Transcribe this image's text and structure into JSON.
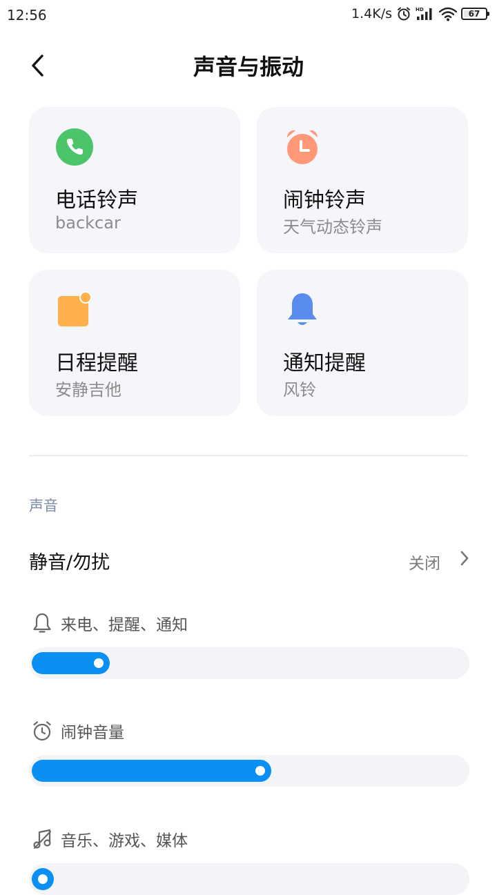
{
  "status_bar": {
    "time": "12:56",
    "net_speed": "1.4K/s",
    "battery": "67"
  },
  "header": {
    "title": "声音与振动"
  },
  "cards": [
    {
      "title": "电话铃声",
      "subtitle": "backcar",
      "icon": "phone-icon",
      "color": "#4cc46a"
    },
    {
      "title": "闹钟铃声",
      "subtitle": "天气动态铃声",
      "icon": "alarm-clock-icon",
      "color": "#ff9878"
    },
    {
      "title": "日程提醒",
      "subtitle": "安静吉他",
      "icon": "calendar-icon",
      "color": "#ffb04a"
    },
    {
      "title": "通知提醒",
      "subtitle": "风铃",
      "icon": "bell-icon",
      "color": "#5a8cf0"
    }
  ],
  "section": {
    "title": "声音"
  },
  "mute_row": {
    "label": "静音/勿扰",
    "value": "关闭"
  },
  "volumes": [
    {
      "label": "来电、提醒、通知",
      "icon": "bell-outline-icon",
      "level": 0.18
    },
    {
      "label": "闹钟音量",
      "icon": "alarm-outline-icon",
      "level": 0.55
    },
    {
      "label": "音乐、游戏、媒体",
      "icon": "music-note-icon",
      "level": 0.04
    }
  ],
  "colors": {
    "accent": "#0a90f4",
    "card_bg": "#f5f6fa",
    "section_header": "#7a8aa8"
  }
}
